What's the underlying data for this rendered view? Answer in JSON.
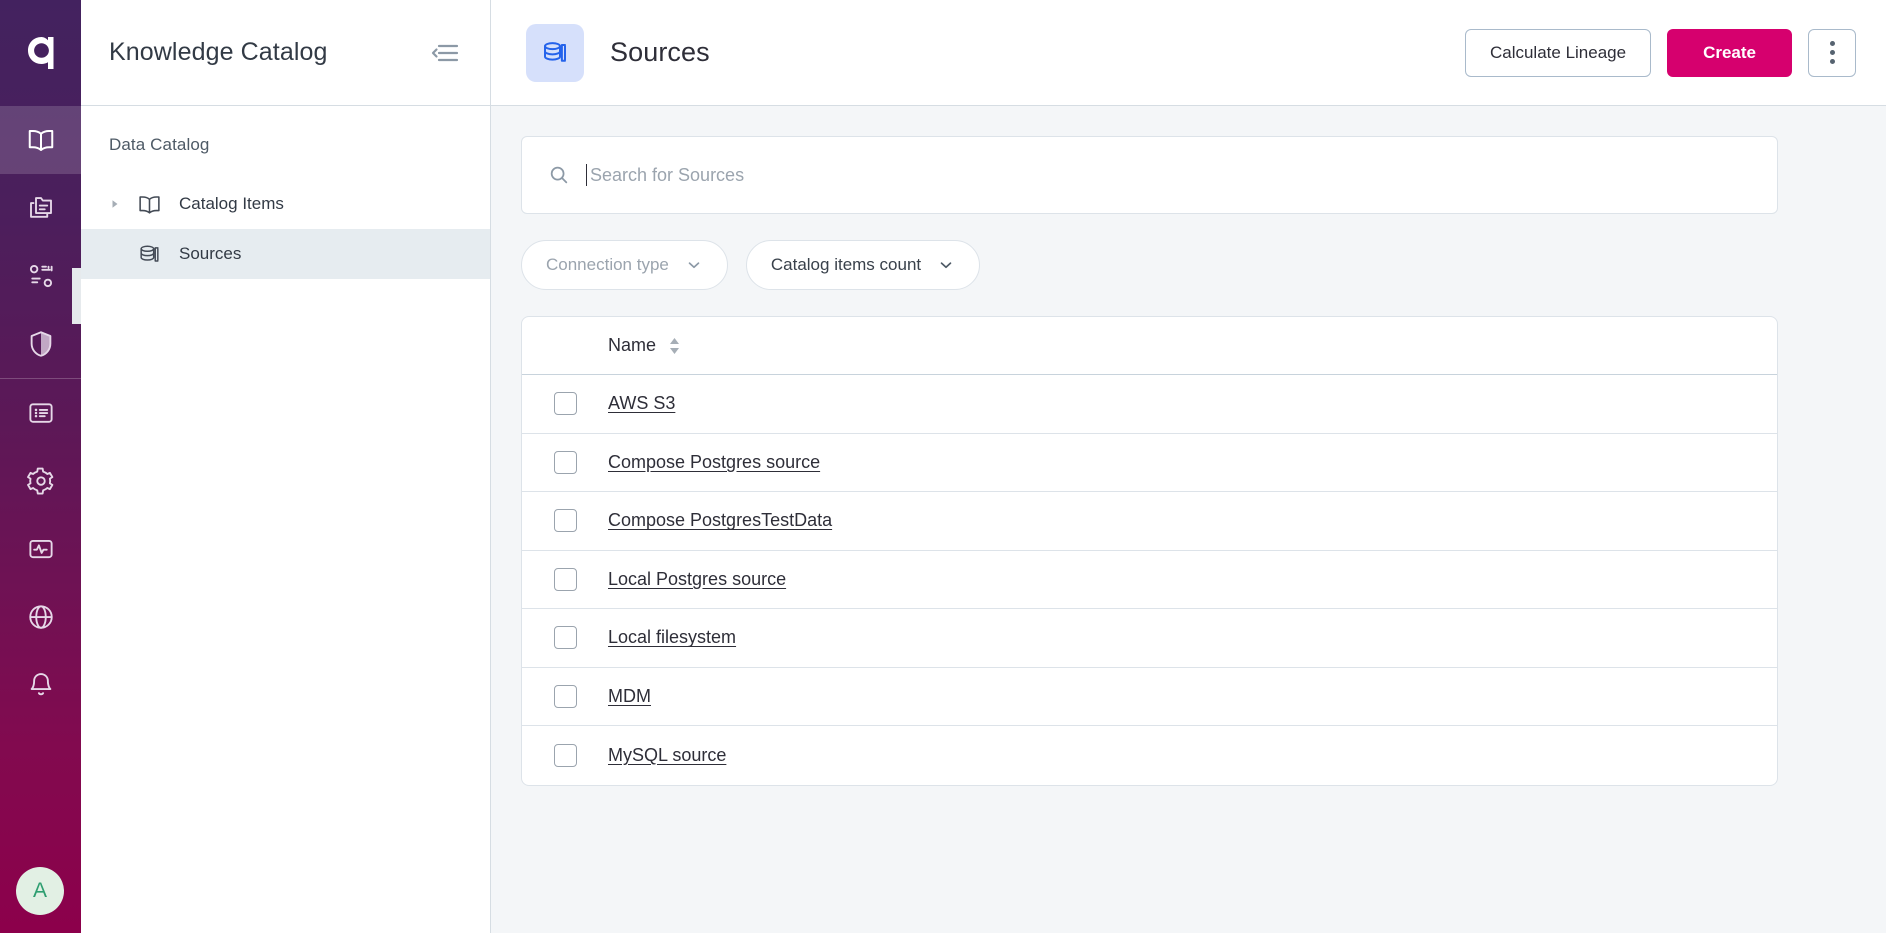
{
  "brand": {
    "logo_icon": "ataccama-a-logo",
    "rail_gradient_from": "#43225F",
    "rail_gradient_to": "#8C004B",
    "accent": "#D6006E"
  },
  "rail": {
    "items": [
      {
        "icon": "book-open-icon",
        "name": "knowledge-catalog",
        "active": true
      },
      {
        "icon": "folder-stack-icon",
        "name": "data-stories",
        "active": false
      },
      {
        "icon": "data-quality-icon",
        "name": "data-quality",
        "active": false
      },
      {
        "icon": "shield-icon",
        "name": "governance",
        "active": false
      },
      {
        "icon": "list-box-icon",
        "name": "tasks",
        "active": false
      },
      {
        "icon": "gear-icon",
        "name": "settings",
        "active": false
      },
      {
        "icon": "monitoring-pulse-icon",
        "name": "monitoring",
        "active": false
      },
      {
        "icon": "globe-icon",
        "name": "global",
        "active": false
      },
      {
        "icon": "bell-icon",
        "name": "notifications",
        "active": false
      }
    ],
    "avatar_initial": "A",
    "avatar_bg": "#E2F0E4",
    "avatar_color": "#2E9E70"
  },
  "sidebar": {
    "title": "Knowledge Catalog",
    "collapse_icon": "collapse-panel-icon",
    "section_label": "Data Catalog",
    "items": [
      {
        "label": "Catalog Items",
        "icon": "book-open-icon",
        "caret": "chevron-right-icon",
        "selected": false
      },
      {
        "label": "Sources",
        "icon": "database-stack-icon",
        "caret": "",
        "selected": true
      }
    ]
  },
  "header": {
    "page_icon": "database-stack-icon",
    "page_icon_bg": "#D6E0FB",
    "title": "Sources",
    "calculate_lineage_label": "Calculate Lineage",
    "create_label": "Create",
    "kebab_icon": "more-vertical-icon"
  },
  "search": {
    "icon": "search-icon",
    "placeholder": "Search for Sources",
    "value": ""
  },
  "filters": [
    {
      "label": "Connection type",
      "icon": "chevron-down-icon",
      "state": "muted"
    },
    {
      "label": "Catalog items count",
      "icon": "chevron-down-icon",
      "state": "dark"
    }
  ],
  "table": {
    "columns": [
      {
        "label": "Name",
        "sort_icon": "sort-arrows-icon"
      }
    ],
    "rows": [
      {
        "checked": false,
        "name": "AWS S3"
      },
      {
        "checked": false,
        "name": "Compose Postgres source"
      },
      {
        "checked": false,
        "name": "Compose PostgresTestData"
      },
      {
        "checked": false,
        "name": "Local Postgres source"
      },
      {
        "checked": false,
        "name": "Local filesystem"
      },
      {
        "checked": false,
        "name": "MDM"
      },
      {
        "checked": false,
        "name": "MySQL source"
      }
    ]
  }
}
